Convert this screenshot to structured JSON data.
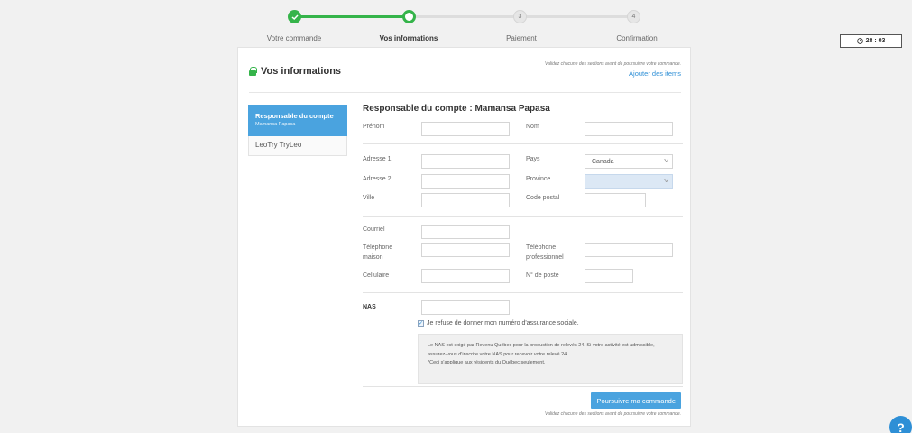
{
  "stepper": {
    "steps": [
      {
        "label": "Votre commande",
        "state": "done",
        "num": ""
      },
      {
        "label": "Vos informations",
        "state": "current",
        "num": ""
      },
      {
        "label": "Paiement",
        "state": "todo",
        "num": "3"
      },
      {
        "label": "Confirmation",
        "state": "todo",
        "num": "4"
      }
    ]
  },
  "timer": {
    "value": "28 : 03",
    "icon": "clock-icon"
  },
  "card": {
    "title": "Vos informations",
    "hint_top": "Validez chacune des sections avant de poursuivre votre commande.",
    "add_items": "Ajouter des items"
  },
  "sidebar": {
    "items": [
      {
        "name": "Responsable du compte",
        "sub": "Mamansa Papasa"
      },
      {
        "name": "LeoTry TryLeo"
      }
    ]
  },
  "form": {
    "title": "Responsable du compte : Mamansa Papasa",
    "labels": {
      "prenom": "Prénom",
      "nom": "Nom",
      "adresse1": "Adresse 1",
      "pays": "Pays",
      "adresse2": "Adresse 2",
      "province": "Province",
      "ville": "Ville",
      "code_postal": "Code postal",
      "courriel": "Courriel",
      "tel_maison": "Téléphone maison",
      "tel_pro": "Téléphone professionnel",
      "cellulaire": "Cellulaire",
      "poste": "N° de poste",
      "nas": "NAS"
    },
    "values": {
      "pays": "Canada",
      "province": ""
    },
    "refuse_nas": "Je refuse de donner mon numéro d'assurance sociale.",
    "notice_line1": "Le NAS est exigé par Revenu Québec pour la production de relevés 24. Si votre activité est admissible, assurez-vous d'inscrire votre NAS pour recevoir votre relevé 24.",
    "notice_line2": "*Ceci s'applique aux résidents du Québec seulement.",
    "submit": "Poursuivre ma commande",
    "hint_bottom": "Validez chacune des sections avant de poursuivre votre commande."
  },
  "help": {
    "label": "?"
  },
  "colors": {
    "accent": "#4aa3df",
    "success": "#35b44a",
    "link": "#2e8fd6"
  }
}
